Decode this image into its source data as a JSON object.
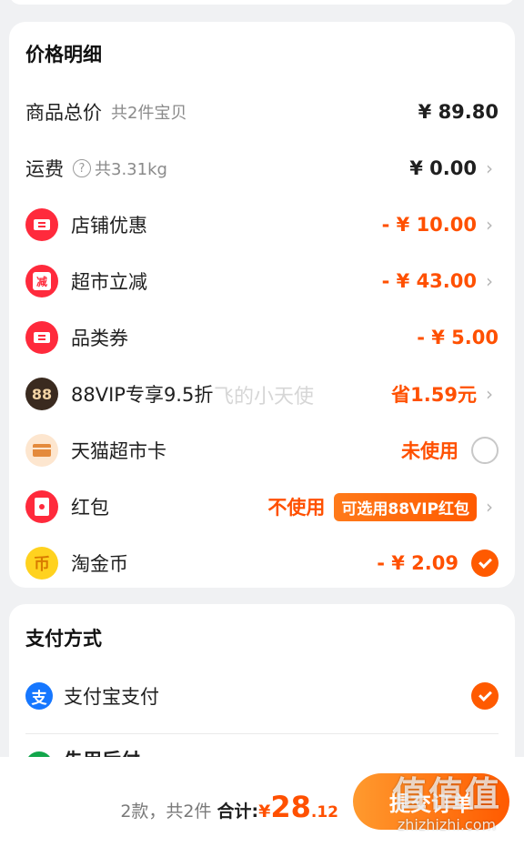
{
  "price_detail": {
    "title": "价格明细",
    "rows": [
      {
        "label": "商品总价",
        "sub": "共2件宝贝",
        "amount": "¥ 89.80"
      },
      {
        "label": "运费",
        "help_icon": "?",
        "sub": "共3.31kg",
        "amount": "¥ 0.00"
      },
      {
        "label": "店铺优惠",
        "amount": "- ¥ 10.00"
      },
      {
        "label": "超市立减",
        "icon_text": "减",
        "amount": "- ¥ 43.00"
      },
      {
        "label": "品类券",
        "amount": "- ¥ 5.00"
      },
      {
        "label": "88VIP专享9.5折",
        "icon_text": "88",
        "amount": "省1.59元"
      },
      {
        "label": "天猫超市卡",
        "amount": "未使用"
      },
      {
        "label": "红包",
        "amount": "不使用",
        "pill": "可选用88VIP红包"
      },
      {
        "label": "淘金币",
        "icon_text": "币",
        "amount": "- ¥ 2.09"
      }
    ],
    "watermark": "飞的小天使"
  },
  "payment": {
    "title": "支付方式",
    "alipay_icon": "支",
    "alipay_label": "支付宝支付",
    "partial_label": "先用后付"
  },
  "bottom_bar": {
    "count": "2款，共2件",
    "total_label": "合计:",
    "currency": "¥",
    "total_int": "28",
    "total_dec": ".12",
    "submit_label": "提交订单"
  },
  "site_watermark": {
    "big": "值值值",
    "small": "zhizhizhi.com"
  },
  "colors": {
    "accent": "#ff5000",
    "coupon_red": "#ff2a3c",
    "alipay_blue": "#1677ff"
  },
  "icons": [
    "coupon-icon",
    "discount-icon",
    "coupon-icon",
    "vip88-icon",
    "store-card-icon",
    "red-packet-icon",
    "gold-coin-icon",
    "alipay-icon"
  ]
}
